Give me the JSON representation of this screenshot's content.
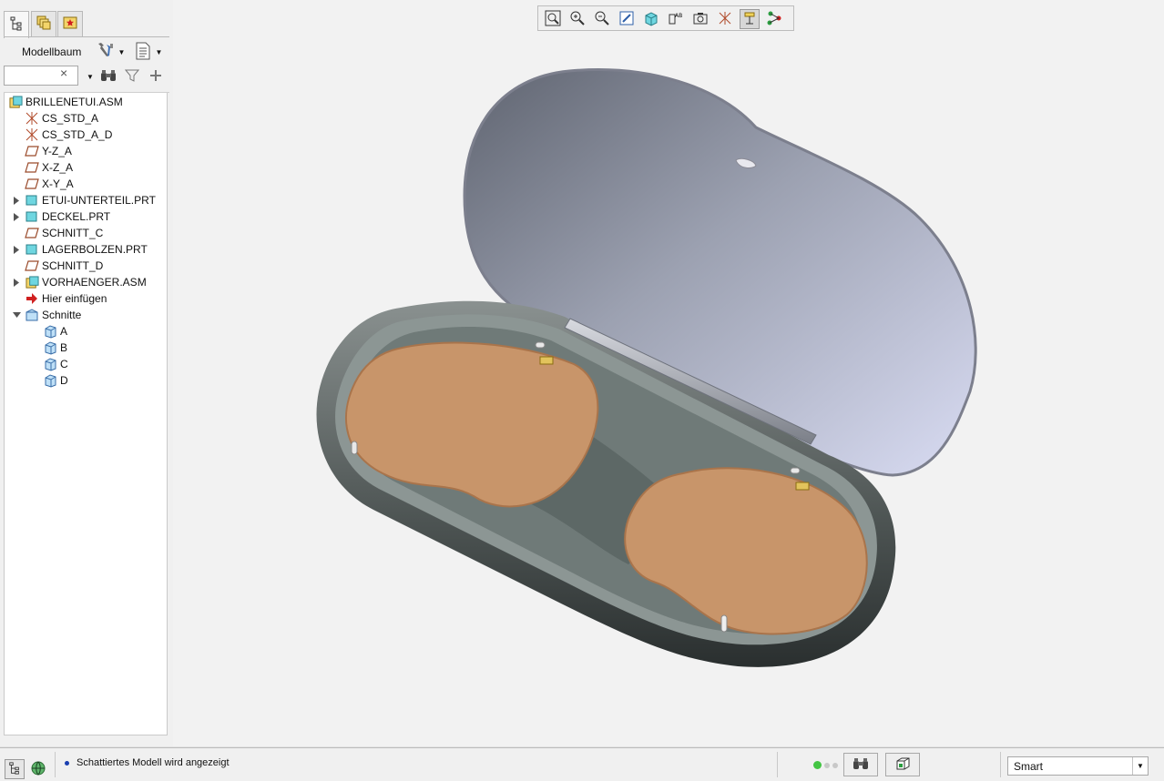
{
  "model_tree": {
    "header_label": "Modellbaum",
    "search": {
      "value": "",
      "placeholder": ""
    },
    "items": [
      {
        "label": "BRILLENETUI.ASM",
        "icon": "assembly-icon",
        "level": 0,
        "expander": "none"
      },
      {
        "label": "CS_STD_A",
        "icon": "coordinate-system-icon",
        "level": 1,
        "expander": "none"
      },
      {
        "label": "CS_STD_A_D",
        "icon": "coordinate-system-icon",
        "level": 1,
        "expander": "none"
      },
      {
        "label": "Y-Z_A",
        "icon": "datum-plane-icon",
        "level": 1,
        "expander": "none"
      },
      {
        "label": "X-Z_A",
        "icon": "datum-plane-icon",
        "level": 1,
        "expander": "none"
      },
      {
        "label": "X-Y_A",
        "icon": "datum-plane-icon",
        "level": 1,
        "expander": "none"
      },
      {
        "label": "ETUI-UNTERTEIL.PRT",
        "icon": "part-icon",
        "level": 1,
        "expander": "collapsed"
      },
      {
        "label": "DECKEL.PRT",
        "icon": "part-icon",
        "level": 1,
        "expander": "collapsed"
      },
      {
        "label": "SCHNITT_C",
        "icon": "datum-plane-icon",
        "level": 1,
        "expander": "none"
      },
      {
        "label": "LAGERBOLZEN.PRT",
        "icon": "part-icon",
        "level": 1,
        "expander": "collapsed"
      },
      {
        "label": "SCHNITT_D",
        "icon": "datum-plane-icon",
        "level": 1,
        "expander": "none"
      },
      {
        "label": "VORHAENGER.ASM",
        "icon": "assembly-icon",
        "level": 1,
        "expander": "collapsed"
      },
      {
        "label": "Hier einfügen",
        "icon": "insert-here-arrow-icon",
        "level": 1,
        "expander": "none"
      },
      {
        "label": "Schnitte",
        "icon": "sections-folder-icon",
        "level": 1,
        "expander": "expanded"
      },
      {
        "label": "A",
        "icon": "section-icon",
        "level": 2,
        "expander": "none"
      },
      {
        "label": "B",
        "icon": "section-icon",
        "level": 2,
        "expander": "none"
      },
      {
        "label": "C",
        "icon": "section-icon",
        "level": 2,
        "expander": "none"
      },
      {
        "label": "D",
        "icon": "section-icon",
        "level": 2,
        "expander": "none"
      }
    ]
  },
  "status_bar": {
    "message": "Schattiertes Modell wird angezeigt",
    "selection_filter": "Smart"
  },
  "colors": {
    "lens": "#c8956a",
    "case_body": "#6f7a78",
    "lid": "#a6abbd",
    "status_dot_active": "#44c544",
    "accent_blue": "#1a3fb0"
  }
}
